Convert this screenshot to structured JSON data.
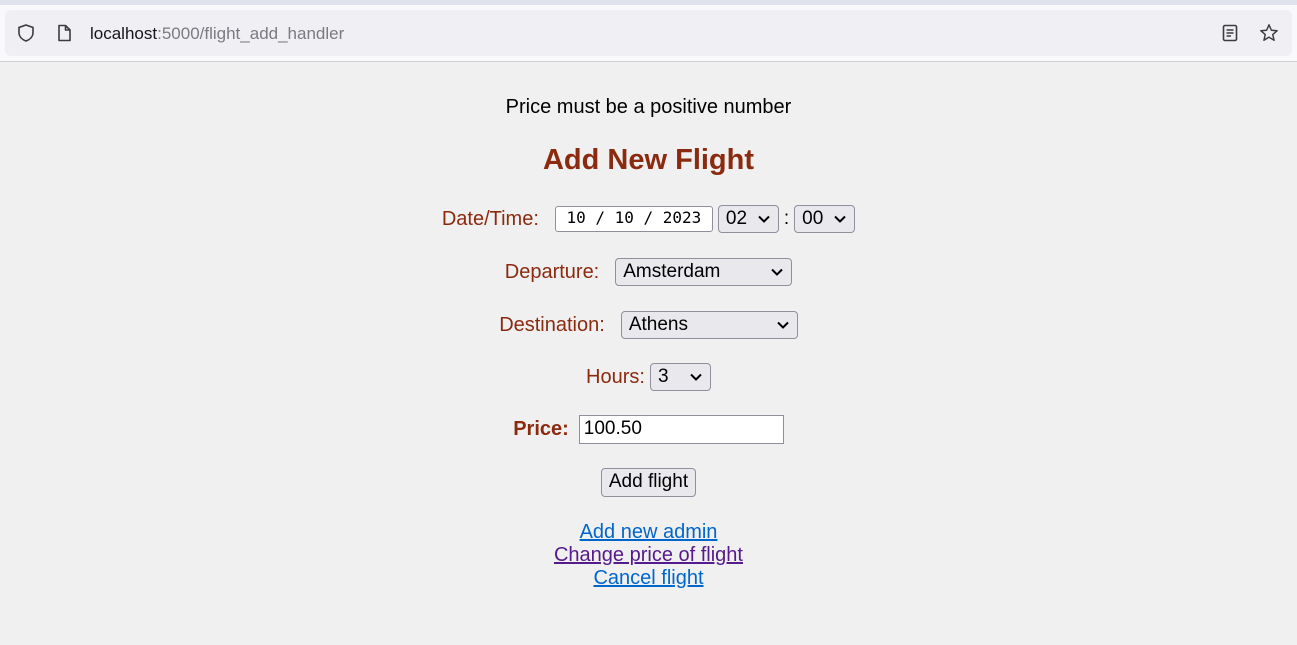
{
  "browser": {
    "url_host": "localhost",
    "url_rest": ":5000/flight_add_handler",
    "icons": [
      "shield-icon",
      "page-icon",
      "reader-view-icon",
      "bookmark-star-icon"
    ]
  },
  "page": {
    "message": "Price must be a positive number",
    "title": "Add New Flight",
    "datetime": {
      "label": "Date/Time:",
      "date_value": "10 / 10 / 2023",
      "hour_value": "02",
      "minute_value": "00",
      "separator": ":"
    },
    "departure": {
      "label": "Departure:",
      "value": "Amsterdam"
    },
    "destination": {
      "label": "Destination:",
      "value": "Athens"
    },
    "hours": {
      "label": "Hours:",
      "value": "3"
    },
    "price": {
      "label": "Price:",
      "value": "100.50"
    },
    "submit_label": "Add flight",
    "links": {
      "add_admin": "Add new admin",
      "change_price": "Change price of flight",
      "cancel_flight": "Cancel flight"
    }
  },
  "colors": {
    "label": "#8b2a0f",
    "link": "#0066cc",
    "visited_link": "#551a8b",
    "background": "#f0f0f0"
  }
}
